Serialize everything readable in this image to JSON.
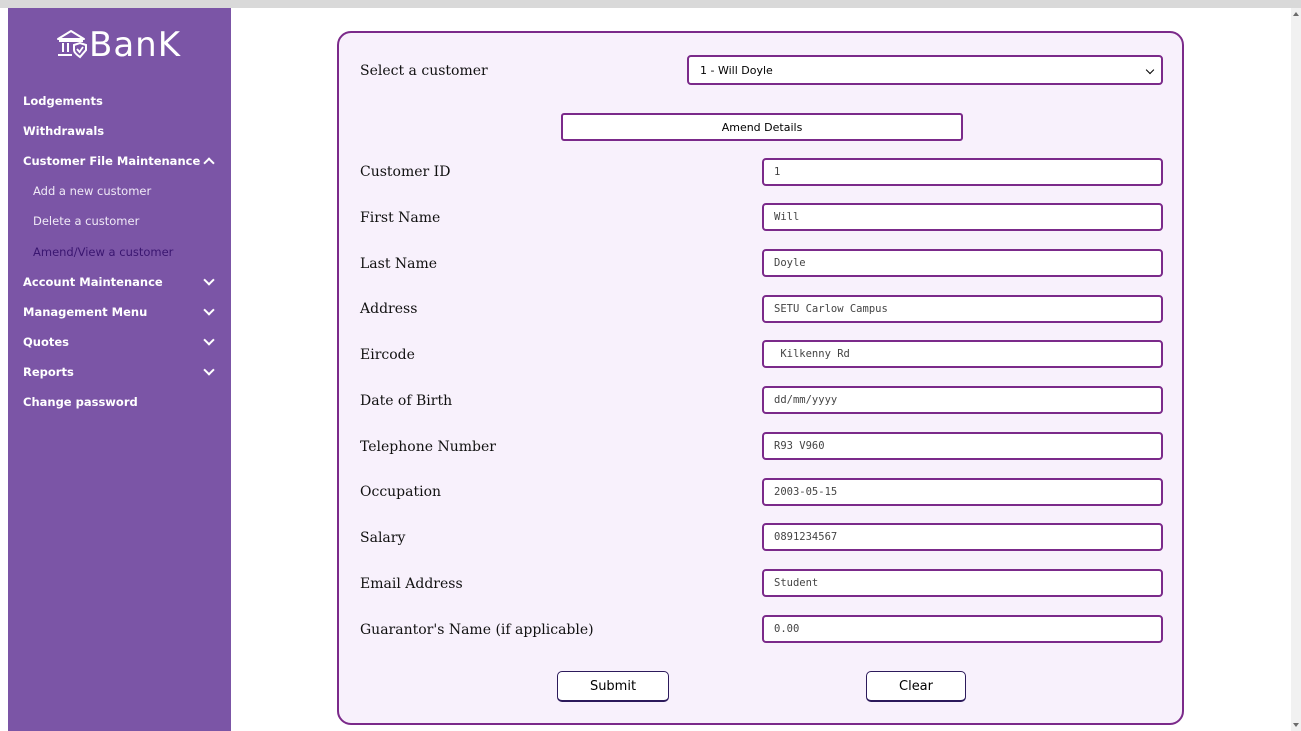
{
  "brand": {
    "logo_text": "BanK",
    "accent": "#7b55a6",
    "border": "#7b2a8a"
  },
  "sidebar": {
    "items": [
      {
        "label": "Lodgements",
        "chevron": ""
      },
      {
        "label": "Withdrawals",
        "chevron": ""
      },
      {
        "label": "Customer File Maintenance",
        "chevron": "up"
      },
      {
        "label": "Add a new customer",
        "sub": true
      },
      {
        "label": "Delete a customer",
        "sub": true
      },
      {
        "label": "Amend/View a customer",
        "sub": true,
        "active": true
      },
      {
        "label": "Account Maintenance",
        "chevron": "down"
      },
      {
        "label": "Management Menu",
        "chevron": "down"
      },
      {
        "label": "Quotes",
        "chevron": "down"
      },
      {
        "label": "Reports",
        "chevron": "down"
      },
      {
        "label": "Change password",
        "chevron": ""
      }
    ]
  },
  "form": {
    "select_label": "Select a customer",
    "select_value": "1 - Will Doyle",
    "amend_button": "Amend Details",
    "fields": [
      {
        "label": "Customer ID",
        "value": "1"
      },
      {
        "label": "First Name",
        "value": "Will"
      },
      {
        "label": "Last Name",
        "value": "Doyle"
      },
      {
        "label": "Address",
        "value": "SETU Carlow Campus"
      },
      {
        "label": "Eircode",
        "value": " Kilkenny Rd"
      },
      {
        "label": "Date of Birth",
        "value": "dd/mm/yyyy"
      },
      {
        "label": "Telephone Number",
        "value": "R93 V960"
      },
      {
        "label": "Occupation",
        "value": "2003-05-15"
      },
      {
        "label": "Salary",
        "value": "0891234567"
      },
      {
        "label": "Email Address",
        "value": "Student"
      },
      {
        "label": "Guarantor's Name (if applicable)",
        "value": "0.00"
      }
    ],
    "submit_label": "Submit",
    "clear_label": "Clear"
  }
}
